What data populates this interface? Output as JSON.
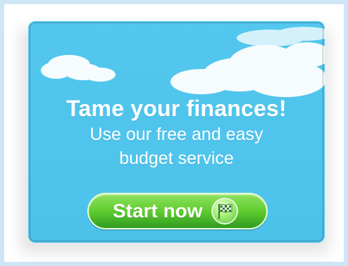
{
  "ad": {
    "headline": "Tame your finances!",
    "subtext_lines": [
      "Use our free and easy",
      "budget service"
    ],
    "cta_label": "Start now",
    "cta_icon": "checkered-flag-icon"
  },
  "colors": {
    "sky": "#4cc2ea",
    "cta_green": "#5fcd2f",
    "text": "#ffffff"
  }
}
